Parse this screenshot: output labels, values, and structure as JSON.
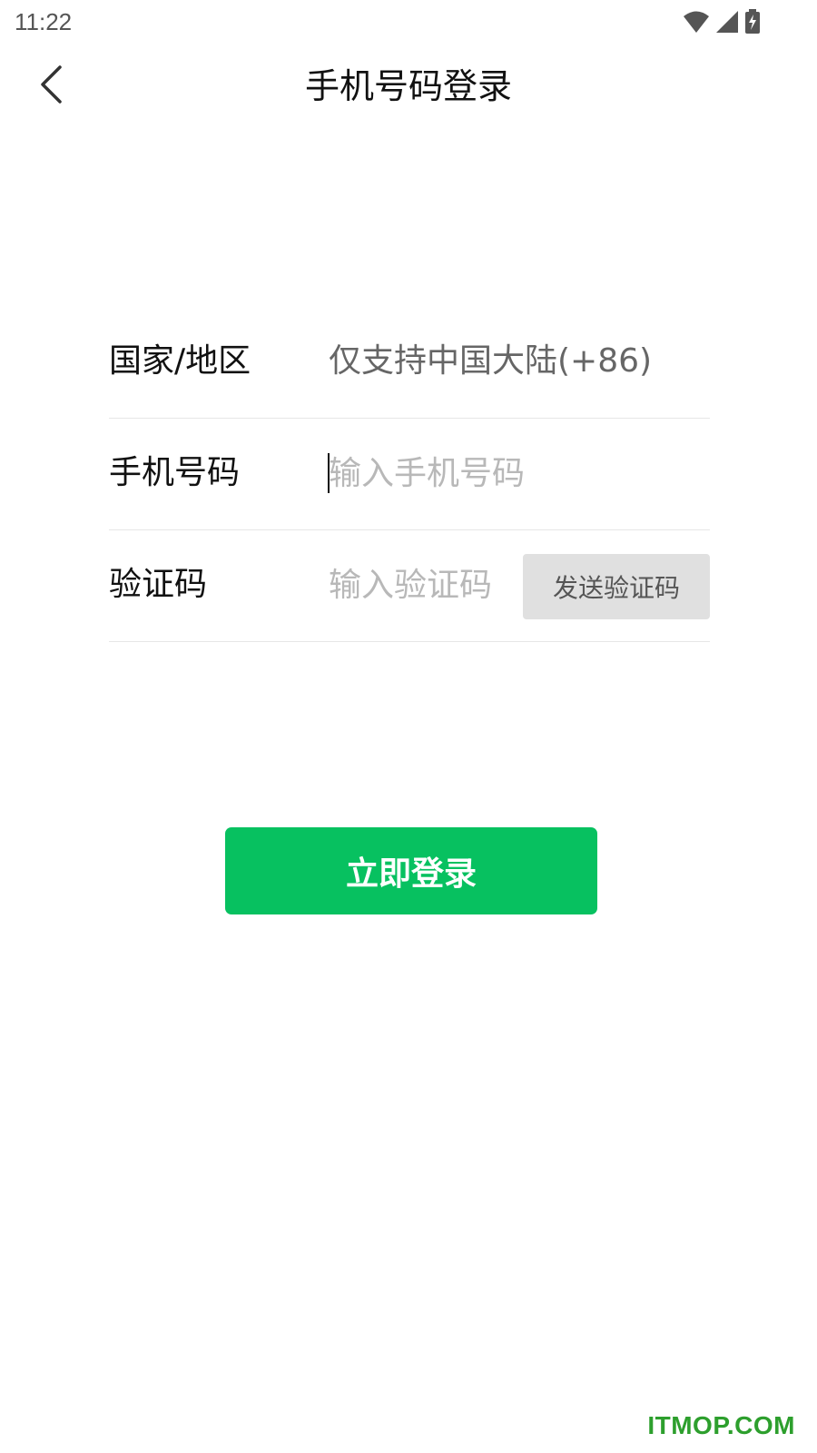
{
  "status_bar": {
    "time": "11:22",
    "icons": [
      "wifi-icon",
      "cellular-signal-icon",
      "battery-charging-icon"
    ]
  },
  "header": {
    "back_icon": "chevron-left-icon",
    "title": "手机号码登录"
  },
  "form": {
    "region": {
      "label": "国家/地区",
      "value": "仅支持中国大陆(+86)"
    },
    "phone": {
      "label": "手机号码",
      "value": "",
      "placeholder": "输入手机号码"
    },
    "code": {
      "label": "验证码",
      "value": "",
      "placeholder": "输入验证码",
      "send_button_label": "发送验证码"
    }
  },
  "login_button_label": "立即登录",
  "watermark": "ITMOP.COM",
  "colors": {
    "primary": "#07c160",
    "send_button_bg": "#e0e0e0",
    "placeholder": "#b8b8b8",
    "watermark": "#2d9f2d"
  }
}
